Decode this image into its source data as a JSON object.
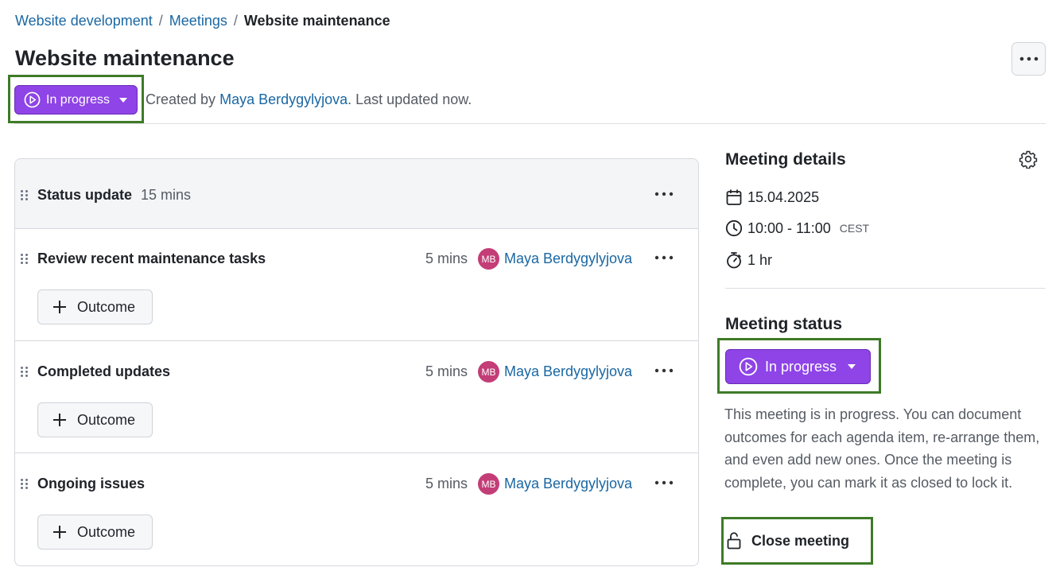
{
  "breadcrumb": {
    "items": [
      "Website development",
      "Meetings"
    ],
    "separator": "/",
    "current": "Website maintenance"
  },
  "page": {
    "title": "Website maintenance",
    "status_label": "In progress",
    "created_prefix": "Created by",
    "creator": "Maya Berdygylyjova",
    "updated_text": ". Last updated now."
  },
  "agenda": {
    "header": {
      "title": "Status update",
      "duration": "15 mins"
    },
    "items": [
      {
        "title": "Review recent maintenance tasks",
        "duration": "5 mins",
        "avatar": "MB",
        "owner": "Maya Berdygylyjova",
        "outcome_label": "Outcome"
      },
      {
        "title": "Completed updates",
        "duration": "5 mins",
        "avatar": "MB",
        "owner": "Maya Berdygylyjova",
        "outcome_label": "Outcome"
      },
      {
        "title": "Ongoing issues",
        "duration": "5 mins",
        "avatar": "MB",
        "owner": "Maya Berdygylyjova",
        "outcome_label": "Outcome"
      }
    ]
  },
  "details": {
    "heading": "Meeting details",
    "date": "15.04.2025",
    "time": "10:00 - 11:00",
    "timezone": "CEST",
    "duration": "1 hr"
  },
  "status_panel": {
    "heading": "Meeting status",
    "button_label": "In progress",
    "description": "This meeting is in progress. You can document outcomes for each agenda item, re-arrange them, and even add new ones. Once the meeting is complete, you can mark it as closed to lock it.",
    "close_label": "Close meeting"
  },
  "icons": {
    "calendar": "calendar-icon",
    "clock": "clock-icon",
    "stopwatch": "stopwatch-icon",
    "gear": "gear-icon",
    "play": "play-circle-icon",
    "unlock": "unlock-icon",
    "drag": "drag-handle-icon",
    "more": "more-horizontal-icon"
  },
  "colors": {
    "status_purple": "#8e44e6",
    "link_blue": "#1a67a3",
    "avatar_pink": "#c33d77",
    "highlight_green": "#3e7b27"
  }
}
